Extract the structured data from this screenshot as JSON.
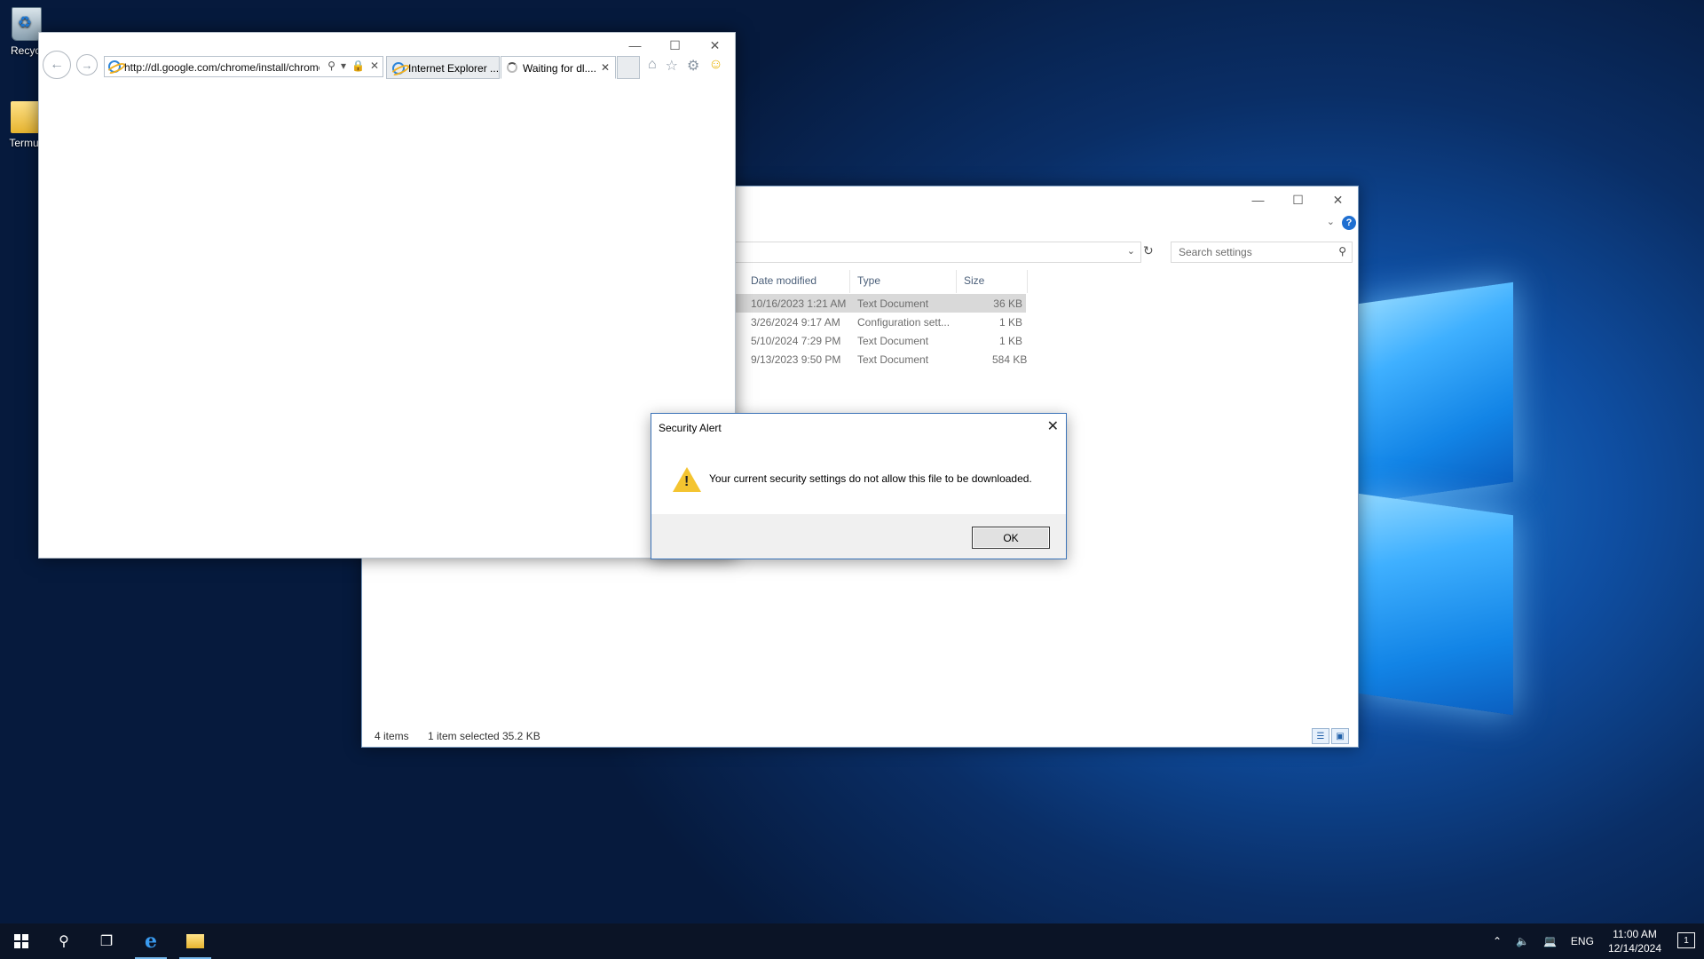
{
  "desktop": {
    "icons": [
      {
        "label": "Recycl",
        "icon": "recycle-bin-icon"
      },
      {
        "label": "Termux",
        "icon": "folder-icon"
      }
    ]
  },
  "ie": {
    "url": "http://dl.google.com/chrome/install/chrome",
    "tabs": [
      {
        "label": "Internet Explorer ...",
        "active": false
      },
      {
        "label": "Waiting for dl....",
        "active": true
      }
    ]
  },
  "explorer": {
    "search_placeholder": "Search settings",
    "columns": [
      "Date modified",
      "Type",
      "Size"
    ],
    "files": [
      {
        "date": "10/16/2023 1:21 AM",
        "type": "Text Document",
        "size": "36 KB",
        "selected": true
      },
      {
        "date": "3/26/2024 9:17 AM",
        "type": "Configuration sett...",
        "size": "1 KB",
        "selected": false
      },
      {
        "date": "5/10/2024 7:29 PM",
        "type": "Text Document",
        "size": "1 KB",
        "selected": false
      },
      {
        "date": "9/13/2023 9:50 PM",
        "type": "Text Document",
        "size": "584 KB",
        "selected": false
      }
    ],
    "status": {
      "items": "4 items",
      "selected": "1 item selected",
      "selected_size": "35.2 KB"
    }
  },
  "dialog": {
    "title": "Security Alert",
    "message": "Your current security settings do not allow this file to be downloaded.",
    "ok_label": "OK"
  },
  "taskbar": {
    "language": "ENG",
    "time": "11:00 AM",
    "date": "12/14/2024",
    "notification_count": "1"
  },
  "colors": {
    "accent": "#1f6fd1",
    "dialog_border": "#3b73b8",
    "selection": "#d9d9d9"
  }
}
